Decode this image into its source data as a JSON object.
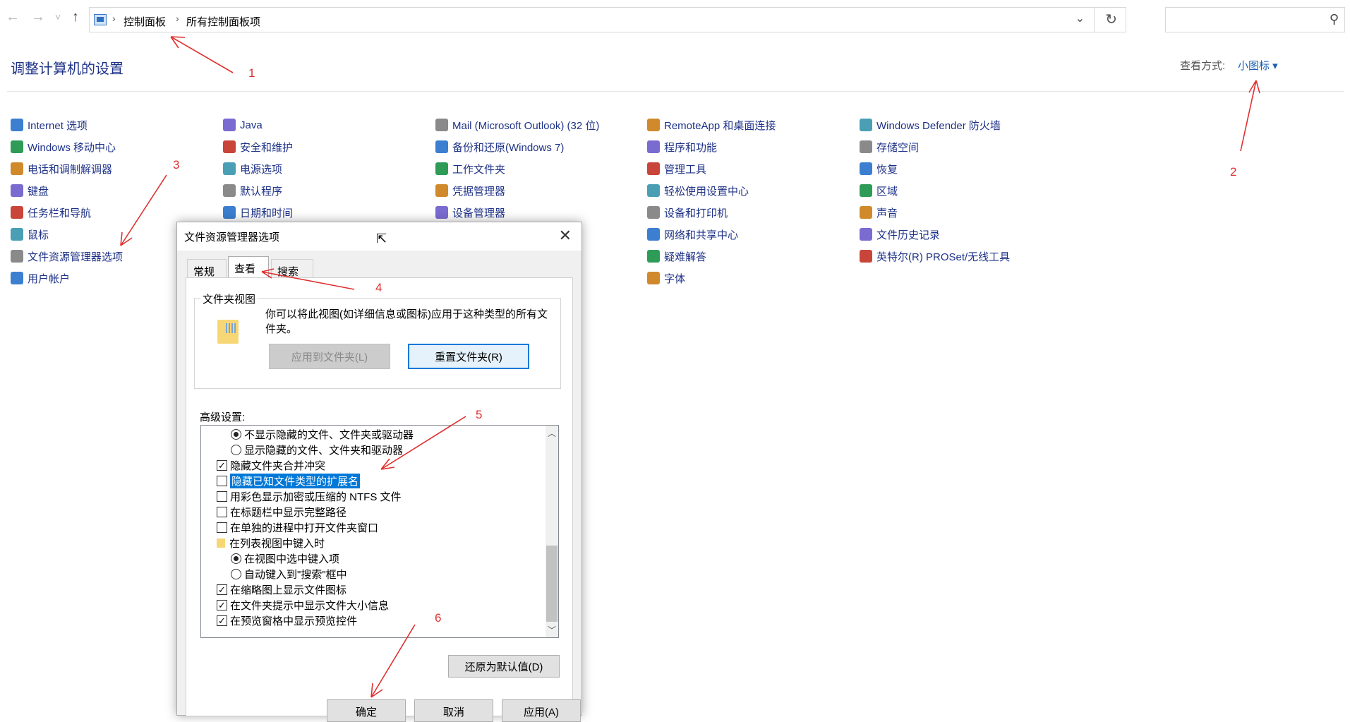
{
  "nav": {
    "back": "←",
    "forward": "→",
    "recent": "˅",
    "up": "↑"
  },
  "address": {
    "crumbs": [
      "控制面板",
      "所有控制面板项"
    ],
    "dropdown": "⌄",
    "refresh": "↻"
  },
  "search": {
    "placeholder": "",
    "icon": "⚲"
  },
  "header": {
    "title": "调整计算机的设置",
    "view_by_label": "查看方式:",
    "view_by_value": "小图标 ▾"
  },
  "items": {
    "col1": [
      "Internet 选项",
      "Windows 移动中心",
      "电话和调制解调器",
      "键盘",
      "任务栏和导航",
      "鼠标",
      "文件资源管理器选项",
      "用户帐户"
    ],
    "col2": [
      "Java",
      "安全和维护",
      "电源选项",
      "默认程序",
      "日期和时间"
    ],
    "col3": [
      "Mail (Microsoft Outlook) (32 位)",
      "备份和还原(Windows 7)",
      "工作文件夹",
      "凭据管理器",
      "设备管理器"
    ],
    "col4": [
      "RemoteApp 和桌面连接",
      "程序和功能",
      "管理工具",
      "轻松使用设置中心",
      "设备和打印机",
      "网络和共享中心",
      "疑难解答",
      "字体"
    ],
    "col5": [
      "Windows Defender 防火墙",
      "存储空间",
      "恢复",
      "区域",
      "声音",
      "文件历史记录",
      "英特尔(R) PROSet/无线工具"
    ]
  },
  "dialog": {
    "title": "文件资源管理器选项",
    "close": "✕",
    "tabs": [
      "常规",
      "查看",
      "搜索"
    ],
    "folder_views": {
      "title": "文件夹视图",
      "desc": "你可以将此视图(如详细信息或图标)应用于这种类型的所有文件夹。",
      "apply_btn": "应用到文件夹(L)",
      "reset_btn": "重置文件夹(R)"
    },
    "advanced_label": "高级设置:",
    "rows": [
      {
        "type": "radio",
        "checked": true,
        "label": "不显示隐藏的文件、文件夹或驱动器",
        "indent": 2
      },
      {
        "type": "radio",
        "checked": false,
        "label": "显示隐藏的文件、文件夹和驱动器",
        "indent": 2
      },
      {
        "type": "check",
        "checked": true,
        "label": "隐藏文件夹合并冲突",
        "indent": 1
      },
      {
        "type": "check",
        "checked": false,
        "label": "隐藏已知文件类型的扩展名",
        "indent": 1,
        "selected": true
      },
      {
        "type": "check",
        "checked": false,
        "label": "用彩色显示加密或压缩的 NTFS 文件",
        "indent": 1
      },
      {
        "type": "check",
        "checked": false,
        "label": "在标题栏中显示完整路径",
        "indent": 1
      },
      {
        "type": "check",
        "checked": false,
        "label": "在单独的进程中打开文件夹窗口",
        "indent": 1
      },
      {
        "type": "folder",
        "label": "在列表视图中键入时",
        "indent": 1
      },
      {
        "type": "radio",
        "checked": true,
        "label": "在视图中选中键入项",
        "indent": 2
      },
      {
        "type": "radio",
        "checked": false,
        "label": "自动键入到\"搜索\"框中",
        "indent": 2
      },
      {
        "type": "check",
        "checked": true,
        "label": "在缩略图上显示文件图标",
        "indent": 1
      },
      {
        "type": "check",
        "checked": true,
        "label": "在文件夹提示中显示文件大小信息",
        "indent": 1
      },
      {
        "type": "check",
        "checked": true,
        "label": "在预览窗格中显示预览控件",
        "indent": 1
      }
    ],
    "restore_btn": "还原为默认值(D)",
    "ok_btn": "确定",
    "cancel_btn": "取消",
    "apply_btn": "应用(A)"
  },
  "annotations": [
    "1",
    "2",
    "3",
    "4",
    "5",
    "6"
  ],
  "colors": {
    "link": "#1e3287",
    "accent": "#0078d7",
    "annotation": "#e0302f"
  }
}
